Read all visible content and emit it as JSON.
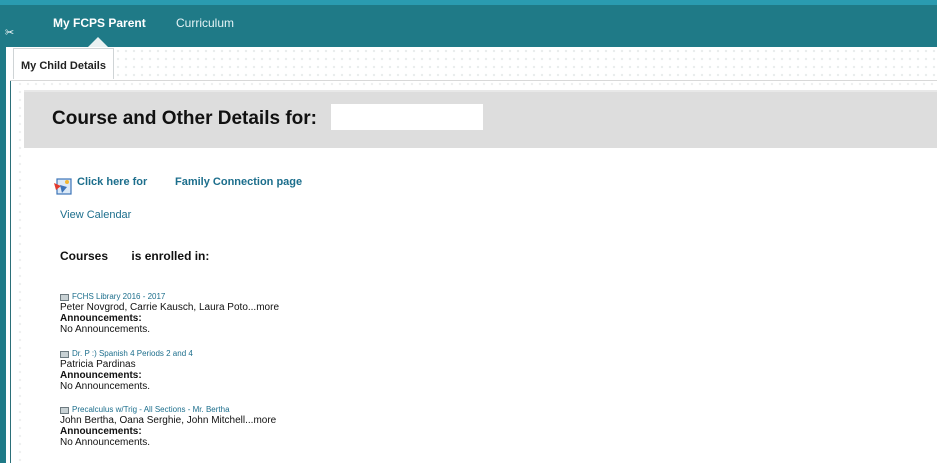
{
  "nav": {
    "tabs": [
      {
        "label": "My FCPS Parent",
        "active": true
      },
      {
        "label": "Curriculum",
        "active": false
      }
    ],
    "subtab": "My Child Details"
  },
  "page": {
    "title": "Course and Other Details for:",
    "family_connection": {
      "prefix": "Click here for",
      "link": "Family Connection page"
    },
    "view_calendar": "View Calendar",
    "courses_heading": {
      "left": "Courses",
      "right": "is enrolled in:"
    }
  },
  "courses": [
    {
      "title": "FCHS Library 2016 - 2017",
      "staff": "Peter Novgrod, Carrie Kausch, Laura Poto...",
      "more": "more",
      "ann_label": "Announcements:",
      "ann_text": "No Announcements."
    },
    {
      "title": "Dr. P :) Spanish 4 Periods 2 and 4",
      "staff": "Patricia Pardinas",
      "more": "",
      "ann_label": "Announcements:",
      "ann_text": "No Announcements."
    },
    {
      "title": "Precalculus w/Trig - All Sections - Mr. Bertha",
      "staff": "John Bertha, Oana Serghie, John Mitchell...",
      "more": "more",
      "ann_label": "Announcements:",
      "ann_text": "No Announcements."
    }
  ],
  "colors": {
    "top_bar": "#1f7a87",
    "link": "#1c6e8c",
    "header_band": "#dddddd"
  },
  "icons": {
    "rail": "link-icon",
    "family_connection": "family-connection-icon",
    "course": "book-icon"
  }
}
